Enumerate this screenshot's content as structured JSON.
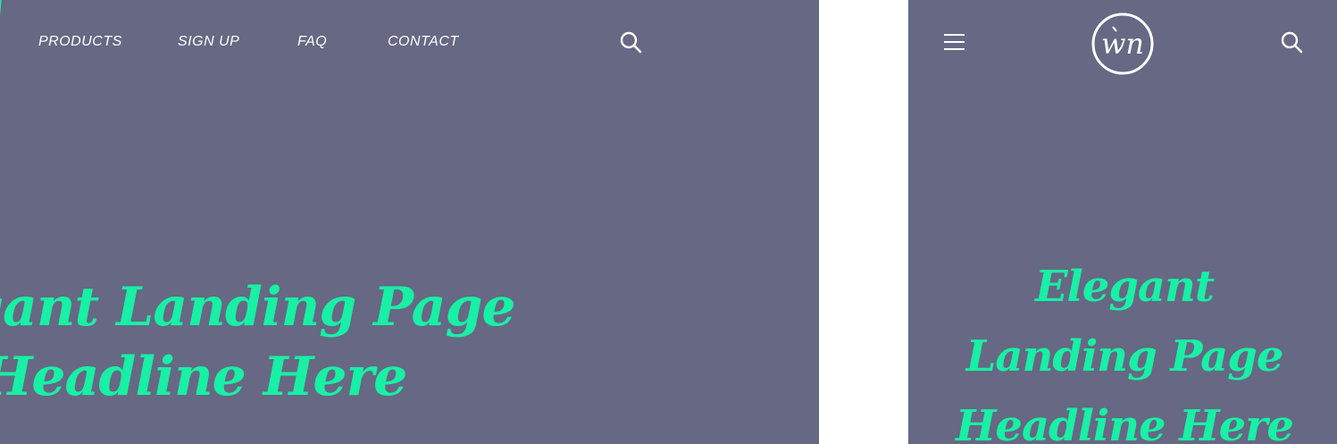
{
  "colors": {
    "background": "#666884",
    "accent": "#18f0a5",
    "nav_text": "#ffffff"
  },
  "desktop": {
    "nav": {
      "items": [
        {
          "label": "PRODUCTS"
        },
        {
          "label": "SIGN UP"
        },
        {
          "label": "FAQ"
        },
        {
          "label": "CONTACT"
        }
      ],
      "search_icon": "search-icon"
    },
    "hero": {
      "headline_line1": "Elegant Landing Page",
      "headline_line2": "Headline Here"
    }
  },
  "mobile": {
    "menu_icon": "hamburger-menu-icon",
    "logo_mark": "wn",
    "search_icon": "search-icon",
    "hero": {
      "headline_line1": "Elegant",
      "headline_line2": "Landing Page",
      "headline_line3": "Headline Here"
    }
  }
}
